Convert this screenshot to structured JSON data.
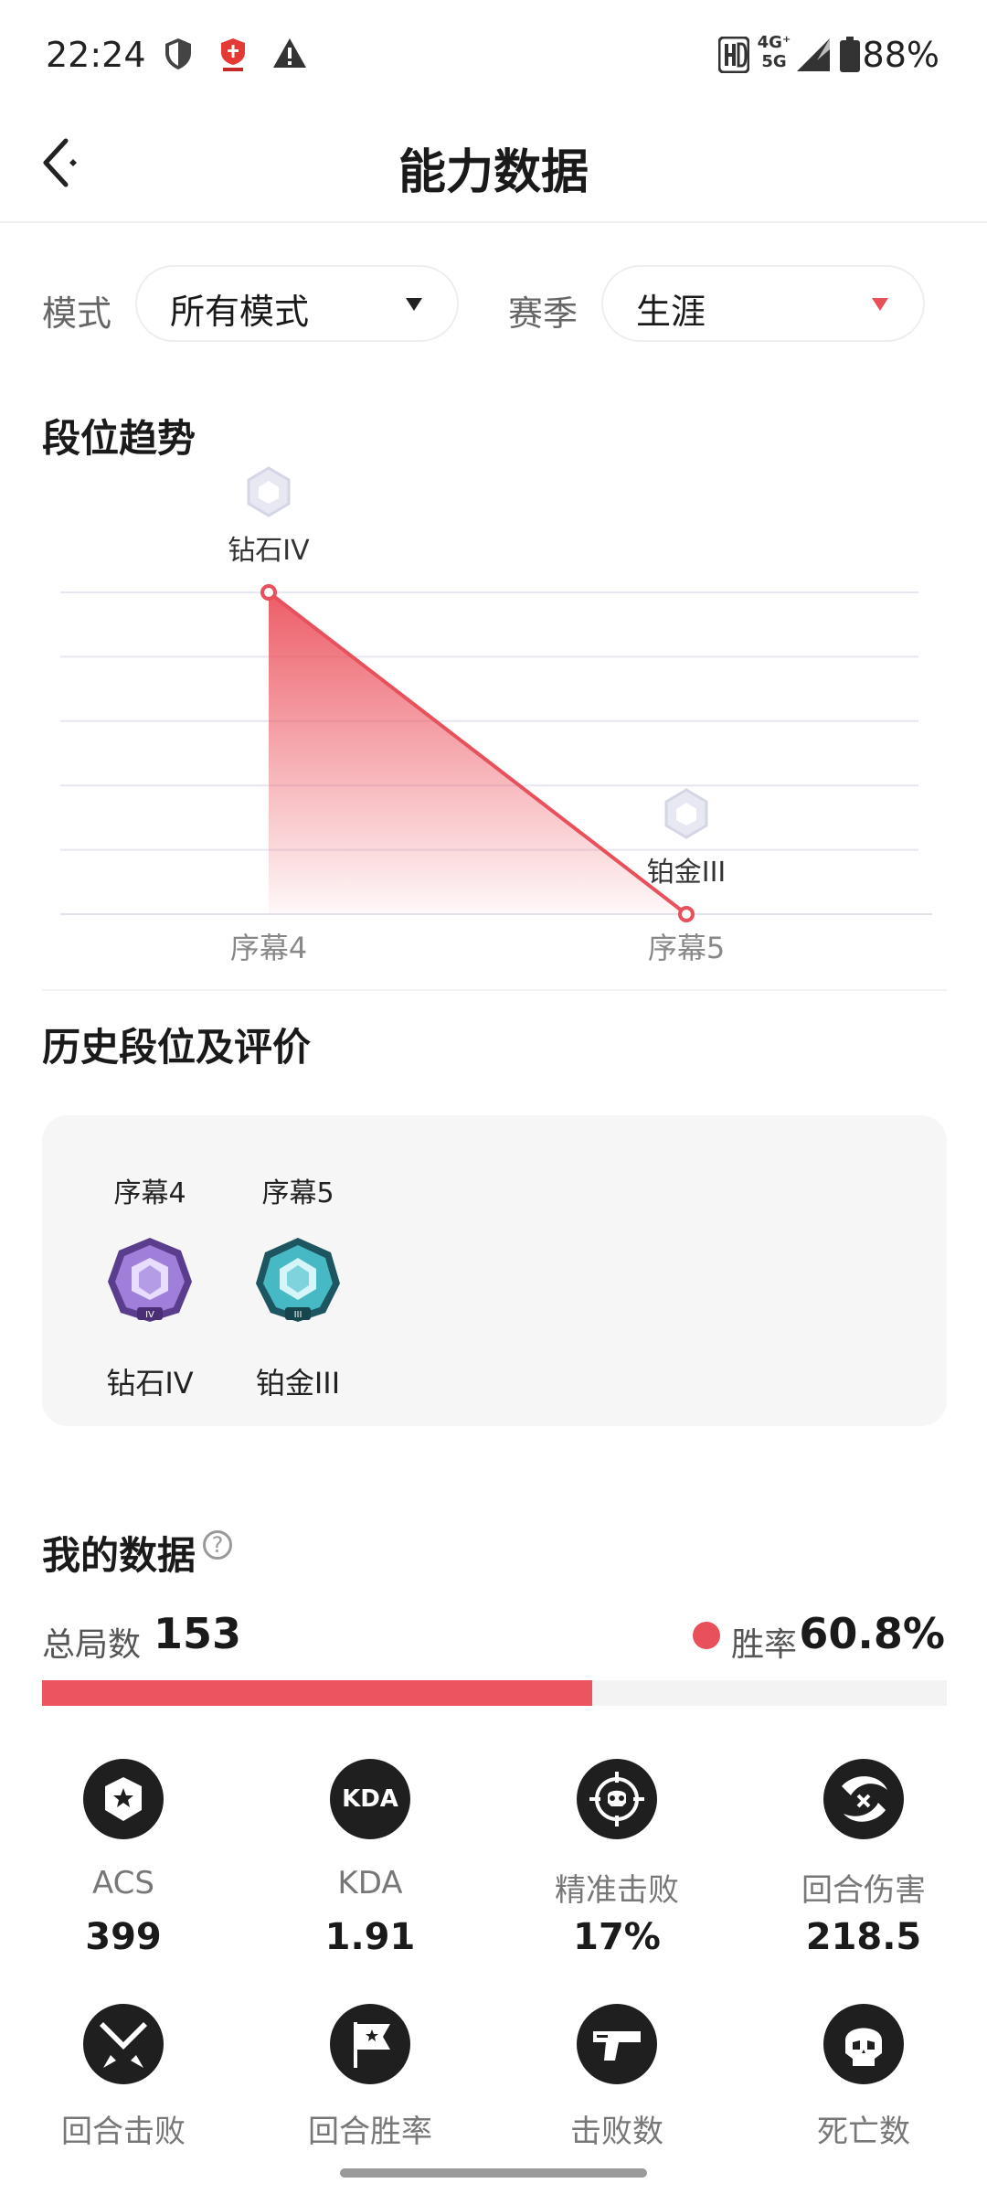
{
  "status_bar": {
    "time": "22:24",
    "network": "4G⁺ 5G",
    "battery": "88%",
    "icons": [
      "shield-icon",
      "app-notification-icon",
      "warning-icon",
      "hd-icon",
      "signal-icon",
      "battery-icon"
    ]
  },
  "header": {
    "title": "能力数据",
    "back_icon": "back-arrow-icon"
  },
  "filters": {
    "mode_label": "模式",
    "mode_value": "所有模式",
    "season_label": "赛季",
    "season_value": "生涯"
  },
  "trend": {
    "title": "段位趋势",
    "chart_data": {
      "type": "line",
      "title": "段位趋势",
      "categories": [
        "序幕4",
        "序幕5"
      ],
      "series": [
        {
          "values": [
            5,
            0
          ],
          "point_labels": [
            "钻石IV",
            "铂金III"
          ]
        }
      ],
      "ylim": [
        0,
        5
      ],
      "grid": true,
      "line_color": "#e8505b"
    }
  },
  "history": {
    "title": "历史段位及评价",
    "items": [
      {
        "season": "序幕4",
        "rank": "钻石IV",
        "badge_numeral": "IV",
        "badge_color": "#8a63c8"
      },
      {
        "season": "序幕5",
        "rank": "铂金III",
        "badge_numeral": "III",
        "badge_color": "#2f9aa8"
      }
    ]
  },
  "my_data": {
    "title": "我的数据",
    "total_label": "总局数",
    "total_value": "153",
    "win_rate_label": "胜率",
    "win_rate_value": "60.8%",
    "win_rate_fraction": 0.608,
    "accent": "#e8505b",
    "stats": [
      {
        "label": "ACS",
        "value": "399",
        "icon": "star-badge-icon"
      },
      {
        "label": "KDA",
        "value": "1.91",
        "icon": "kda-icon",
        "icon_text": "KDA"
      },
      {
        "label": "精准击败",
        "value": "17%",
        "icon": "crosshair-skull-icon"
      },
      {
        "label": "回合伤害",
        "value": "218.5",
        "icon": "damage-slash-icon"
      },
      {
        "label": "回合击败",
        "icon": "crossed-blades-icon"
      },
      {
        "label": "回合胜率",
        "icon": "star-flag-icon"
      },
      {
        "label": "击败数",
        "icon": "pistol-icon"
      },
      {
        "label": "死亡数",
        "icon": "skull-icon"
      }
    ]
  }
}
